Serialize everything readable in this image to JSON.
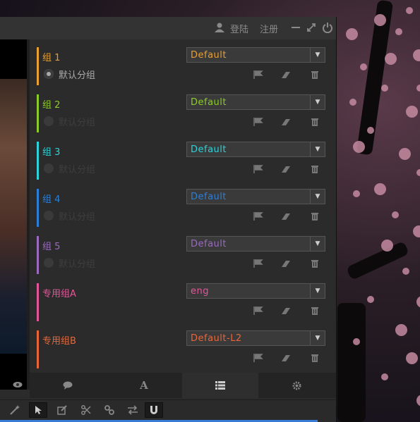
{
  "titlebar": {
    "login": "登陆",
    "register": "注册"
  },
  "groups": [
    {
      "name": "组 1",
      "color": "#e8a033",
      "option": "Default",
      "radio_label": "默认分组",
      "selected": true
    },
    {
      "name": "组 2",
      "color": "#8ccc2a",
      "option": "Default",
      "radio_label": "默认分组",
      "selected": false
    },
    {
      "name": "组 3",
      "color": "#2ed2d8",
      "option": "Default",
      "radio_label": "默认分组",
      "selected": false
    },
    {
      "name": "组 4",
      "color": "#2c7fd6",
      "option": "Default",
      "radio_label": "默认分组",
      "selected": false
    },
    {
      "name": "组 5",
      "color": "#9a6bbf",
      "option": "Default",
      "radio_label": "默认分组",
      "selected": false
    },
    {
      "name": "专用组A",
      "color": "#e2579a",
      "option": "eng",
      "radio_label": "",
      "selected": false
    },
    {
      "name": "专用组B",
      "color": "#e8673a",
      "option": "Default-L2",
      "radio_label": "",
      "selected": false
    }
  ],
  "tabs": [
    "chat-icon",
    "font-icon",
    "list-icon",
    "gear-icon"
  ],
  "active_tab": 2,
  "tools": [
    "magic-wand-icon",
    "pointer-icon",
    "edit-icon",
    "scissors-icon",
    "link-icon",
    "swap-icon",
    "magnet-icon"
  ],
  "selected_tools": [
    1,
    6
  ]
}
